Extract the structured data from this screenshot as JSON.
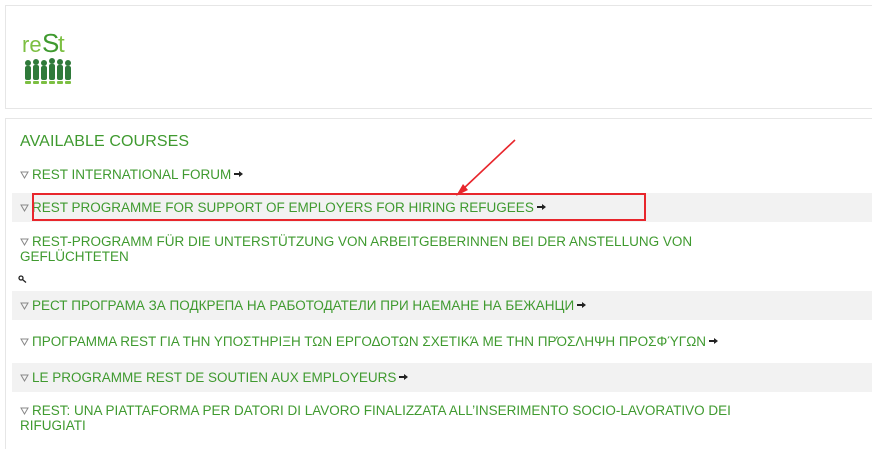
{
  "brand": {
    "logo_text": "reSt",
    "accent_color": "#3f9a2f",
    "annotation_color": "#e8262c"
  },
  "courses_section": {
    "title": "AVAILABLE COURSES",
    "courses": [
      {
        "line1": "REST INTERNATIONAL FORUM",
        "line2": "",
        "enrol_icon": true
      },
      {
        "line1": "REST PROGRAMME FOR SUPPORT OF EMPLOYERS FOR HIRING REFUGEES",
        "line2": "",
        "enrol_icon": true
      },
      {
        "line1": "REST-PROGRAMM FÜR DIE UNTERSTÜTZUNG VON ARBEITGEBERINNEN BEI DER ANSTELLUNG VON",
        "line2": "GEFLÜCHTETEN",
        "enrol_icon": false,
        "key_icon": true
      },
      {
        "line1": "РЕСТ ПРОГРАМА ЗА ПОДКРЕПА НА РАБОТОДАТЕЛИ ПРИ НАЕМАНЕ НА БЕЖАНЦИ",
        "line2": "",
        "enrol_icon": true
      },
      {
        "line1": "ΠΡΟΓΡΑΜΜΑ REST ΓΙΑ ΤΗΝ ΥΠΟΣΤΗΡΙΞΗ ΤΩΝ ΕΡΓΟΔΟΤΩΝ ΣΧΕΤΙΚΆ ΜΕ ΤΗΝ ΠΡΌΣΛΗΨΗ ΠΡΟΣΦΎΓΩΝ",
        "line2": "",
        "enrol_icon": true
      },
      {
        "line1": "LE PROGRAMME REST DE SOUTIEN AUX EMPLOYEURS",
        "line2": "",
        "enrol_icon": true
      },
      {
        "line1": "REST: UNA PIATTAFORMA PER DATORI DI LAVORO FINALIZZATA ALL’INSERIMENTO SOCIO-LAVORATIVO DEI",
        "line2": "RIFUGIATI",
        "enrol_icon": false
      }
    ]
  }
}
